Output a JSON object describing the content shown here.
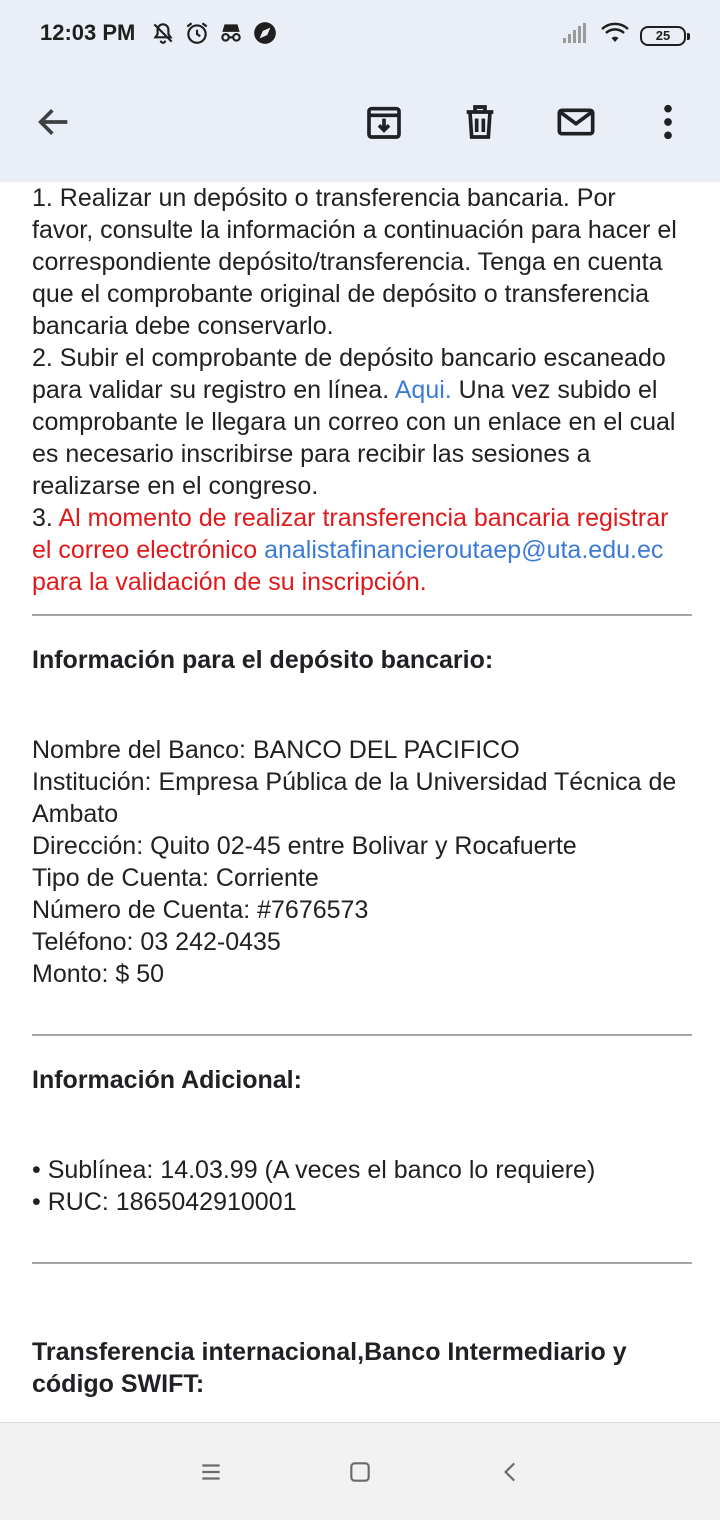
{
  "status_bar": {
    "time": "12:03 PM",
    "battery": "25",
    "left_icons": [
      "mute-icon",
      "alarm-icon",
      "incognito-icon",
      "compass-icon"
    ],
    "right_icons": [
      "signal-icon",
      "wifi-icon",
      "battery-icon"
    ]
  },
  "toolbar": {
    "back_icon": "arrow-back-icon",
    "archive_icon": "archive-icon",
    "delete_icon": "trash-icon",
    "mail_icon": "mail-icon",
    "more_icon": "more-vert-icon"
  },
  "email": {
    "step1_clipped": "1. Realizar un depósito o transferencia bancaria. Por",
    "step1_rest": "favor, consulte la información a continuación para hacer el correspondiente depósito/transferencia. Tenga en cuenta que el comprobante original de depósito o transferencia bancaria debe conservarlo.",
    "step2_text": "2. Subir el comprobante de depósito bancario escaneado para validar su registro en línea.",
    "step2_link": "Aqui.",
    "step2_rest": "Una vez subido el comprobante le llegara un correo con un enlace en el cual es necesario inscribirse para recibir las sesiones a realizarse en el congreso.",
    "step3_number": "3.",
    "step3_red_a": "Al momento de realizar transferencia bancaria registrar el correo electrónico",
    "step3_email": "analistafinancieroutaep@uta.edu.ec",
    "step3_red_b": "para la validación de su inscripción.",
    "deposit_heading": "Información para el depósito bancario:",
    "deposit_lines": [
      "Nombre del Banco: BANCO DEL PACIFICO",
      "Institución: Empresa Pública de la Universidad Técnica de Ambato",
      "Dirección: Quito 02-45 entre Bolivar y Rocafuerte",
      "Tipo de Cuenta: Corriente",
      "Número de Cuenta: #7676573",
      "Teléfono: 03 242-0435",
      "Monto: $ 50"
    ],
    "additional_heading": "Información Adicional:",
    "additional_lines": [
      "• Sublínea: 14.03.99 (A veces el banco lo requiere)",
      "• RUC: 1865042910001"
    ],
    "international_heading": "Transferencia internacional,Banco Intermediario y código SWIFT:"
  },
  "nav_bar": {
    "menu_icon": "menu-icon",
    "home_icon": "home-square-icon",
    "back_icon": "back-chevron-icon"
  },
  "colors": {
    "header_bg": "#eaeef6",
    "link": "#3b7bd8",
    "red": "#e0191b",
    "divider": "#a6a6a6"
  }
}
